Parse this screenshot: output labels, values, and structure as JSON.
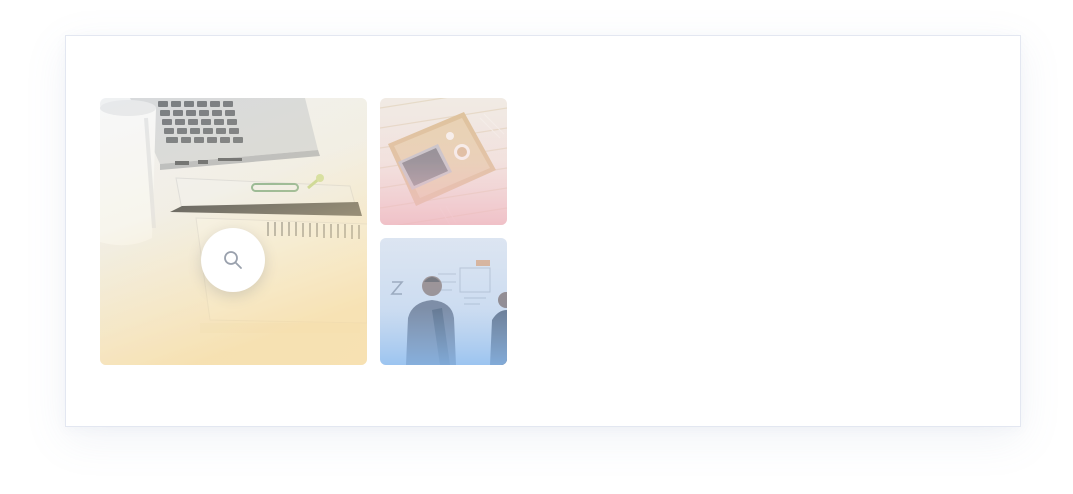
{
  "gallery": {
    "images": [
      {
        "subject": "laptop-notebook-mug-desk",
        "overlay": "yellow-gradient"
      },
      {
        "subject": "laptop-on-tray-flatlay",
        "overlay": "pink-gradient"
      },
      {
        "subject": "people-at-whiteboard",
        "overlay": "blue-gradient"
      }
    ],
    "zoom_icon": "search-icon"
  },
  "colors": {
    "card_border": "#e3e7f1",
    "overlay_yellow": "#f7dc93",
    "overlay_pink": "#f1b9c3",
    "overlay_blue": "#8ebdf0"
  }
}
